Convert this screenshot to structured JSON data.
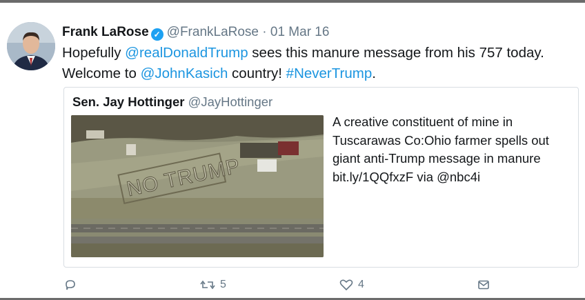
{
  "tweet": {
    "author_name": "Frank LaRose",
    "author_handle": "@FrankLaRose",
    "separator": "·",
    "date": "01 Mar 16",
    "text_parts": {
      "p1": "Hopefully ",
      "mention1": "@realDonaldTrump",
      "p2": " sees this manure message from his 757 today. Welcome to ",
      "mention2": "@JohnKasich",
      "p3": " country! ",
      "hashtag": "#NeverTrump",
      "p4": "."
    },
    "verified_icon": "verified-badge-icon"
  },
  "quote": {
    "author_name": "Sen. Jay Hottinger",
    "author_handle": "@JayHottinger",
    "text": "A creative constituent of mine in Tuscarawas Co:Ohio farmer spells out giant anti-Trump message in manure bit.ly/1QQfxzF via @nbc4i",
    "image_lettering": "NO TRUMP"
  },
  "actions": {
    "reply": {
      "icon": "reply-icon",
      "count": ""
    },
    "retweet": {
      "icon": "retweet-icon",
      "count": "5"
    },
    "like": {
      "icon": "heart-icon",
      "count": "4"
    },
    "dm": {
      "icon": "direct-message-icon",
      "count": ""
    }
  },
  "colors": {
    "link": "#1b95e0",
    "muted": "#657786",
    "verified": "#1da1f2",
    "border": "#d8dde2"
  }
}
